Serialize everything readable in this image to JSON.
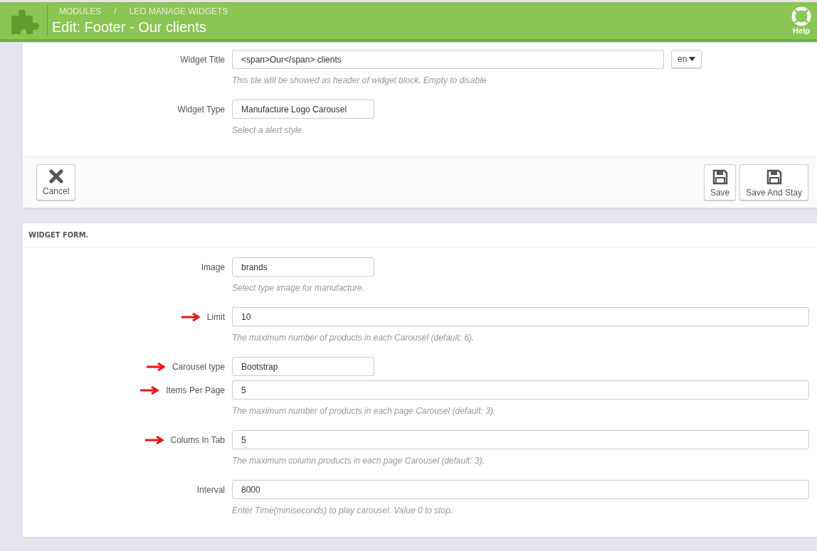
{
  "header": {
    "breadcrumb": [
      "MODULES",
      "LEO MANAGE WIDGETS"
    ],
    "separator": "/",
    "title": "Edit: Footer - Our clients",
    "help": "Help"
  },
  "top_form": {
    "fields": [
      {
        "label": "Widget Title",
        "value": "<span>Our</span> clients",
        "kind": "wide",
        "language": "en",
        "hint": "This tile will be showed as header of widget block. Empty to disable",
        "marked": false
      },
      {
        "label": "Widget Type",
        "value": "Manufacture Logo Carousel",
        "kind": "narrow",
        "hint": "Select a alert style",
        "marked": false
      }
    ],
    "buttons": [
      {
        "label": "Cancel",
        "kind": "cancel"
      },
      {
        "label": "Save",
        "kind": "save"
      },
      {
        "label": "Save And Stay",
        "kind": "save"
      }
    ]
  },
  "widget_form": {
    "heading": "WIDGET FORM.",
    "fields": [
      {
        "label": "Image",
        "value": "brands",
        "kind": "narrow",
        "hint": "Select type image for manufacture.",
        "marked": false
      },
      {
        "label": "Limit",
        "value": "10",
        "kind": "wide",
        "hint": "The maximum number of products in each Carousel (default: 6).",
        "marked": true
      },
      {
        "label": "Carousel type",
        "value": "Bootstrap",
        "kind": "narrow",
        "marked": true
      },
      {
        "label": "Items Per Page",
        "value": "5",
        "kind": "wide",
        "hint": "The maximum number of products in each page Carousel (default: 3).",
        "marked": true
      },
      {
        "label": "Colums In Tab",
        "value": "5",
        "kind": "wide",
        "hint": "The maximum column products in each page Carousel (default: 3).",
        "marked": true
      },
      {
        "label": "Interval",
        "value": "8000",
        "kind": "wide",
        "hint": "Enter Time(miniseconds) to play carousel. Value 0 to stop.",
        "marked": false
      }
    ]
  }
}
